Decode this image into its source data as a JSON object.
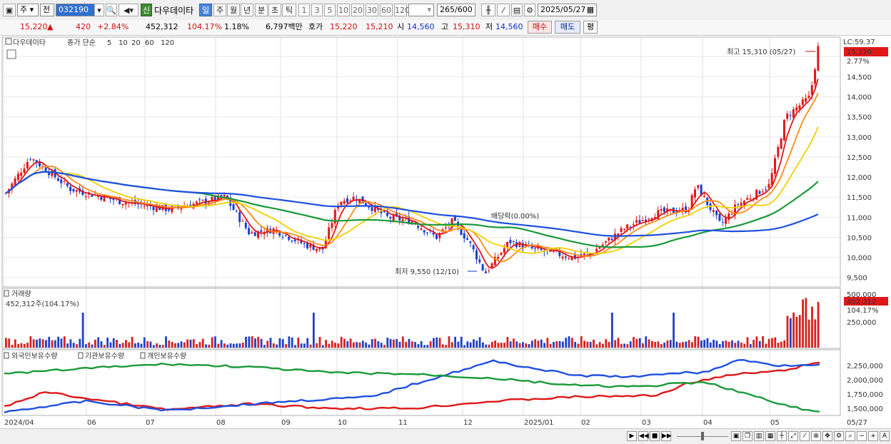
{
  "toolbar": {
    "market": "주",
    "scope": "전",
    "code": "032190",
    "new_label": "신",
    "stock_name": "다우데이타",
    "periods": [
      "일",
      "주",
      "월",
      "년",
      "분",
      "초",
      "틱"
    ],
    "selected_period": "일",
    "intervals": [
      "1",
      "3",
      "5",
      "10",
      "20",
      "30",
      "60",
      "120"
    ],
    "count": "265",
    "count_total": "/600",
    "date": "2025/05/27"
  },
  "price_bar": {
    "price": "15,220",
    "change_arrow": "▲",
    "change": "420",
    "change_pct": "+2.84%",
    "volume": "452,312",
    "volume_ratio": "104.17%",
    "turnover": "1.18%",
    "amount": "6,797백만",
    "quote_label": "호가",
    "ask": "15,220",
    "bid": "15,210",
    "open_label": "시",
    "open": "14,560",
    "high_label": "고",
    "high": "15,310",
    "low_label": "저",
    "low": "14,560",
    "buy_label": "매수",
    "sell_label": "매도",
    "eval_label": "평"
  },
  "price_panel": {
    "legend_name": "다우데이타",
    "legend_ma_label": "종가 단순",
    "ma_periods": [
      "5",
      "10",
      "20",
      "60",
      "120"
    ],
    "ma_colors": [
      "#e01818",
      "#ff8c1a",
      "#f0d000",
      "#1a9a3a",
      "#2050e0"
    ],
    "lc_label": "LC:59.37",
    "current_price_tag": "15,220",
    "pct_tag": "2.77%",
    "y_ticks": [
      "14,500",
      "14,000",
      "13,500",
      "13,000",
      "12,500",
      "12,000",
      "11,500",
      "11,000",
      "10,500",
      "10,000",
      "9,500"
    ],
    "high_annotation": "최고 15,310 (05/27)",
    "low_annotation": "최저 9,550 (12/10)",
    "dividend_annotation": "배당락(0.00%)"
  },
  "volume_panel": {
    "title": "거래량",
    "value_label": "452,312주(104.17%)",
    "y_ticks": [
      "500,000",
      "250,000"
    ],
    "tag_value": "452,312",
    "tag_pct": "104.17%"
  },
  "holding_panel": {
    "legend": [
      "외국인보유수량",
      "기관보유수량",
      "개인보유수량"
    ],
    "colors": [
      "#e01818",
      "#2050e0",
      "#1a9a3a"
    ],
    "y_ticks": [
      "2,250,000",
      "2,000,000",
      "1,750,000",
      "1,500,000"
    ]
  },
  "x_axis": {
    "labels": [
      "2024/04",
      "06",
      "07",
      "08",
      "09",
      "10",
      "11",
      "12",
      "2025/01",
      "02",
      "03",
      "04",
      "05"
    ],
    "end_label": "05/27"
  },
  "chart_data": {
    "type": "line",
    "title": "다우데이타",
    "x": [
      "2024/04",
      "06",
      "07",
      "08",
      "09",
      "10",
      "11",
      "12",
      "2025/01",
      "02",
      "03",
      "04",
      "05",
      "05/27"
    ],
    "series": [
      {
        "name": "종가",
        "values": [
          11600,
          11700,
          11300,
          11000,
          10200,
          11400,
          10900,
          9800,
          10200,
          10300,
          11200,
          10900,
          12000,
          15220
        ]
      }
    ],
    "ylim": [
      9300,
      15450
    ],
    "high": 15310,
    "low": 9550
  }
}
